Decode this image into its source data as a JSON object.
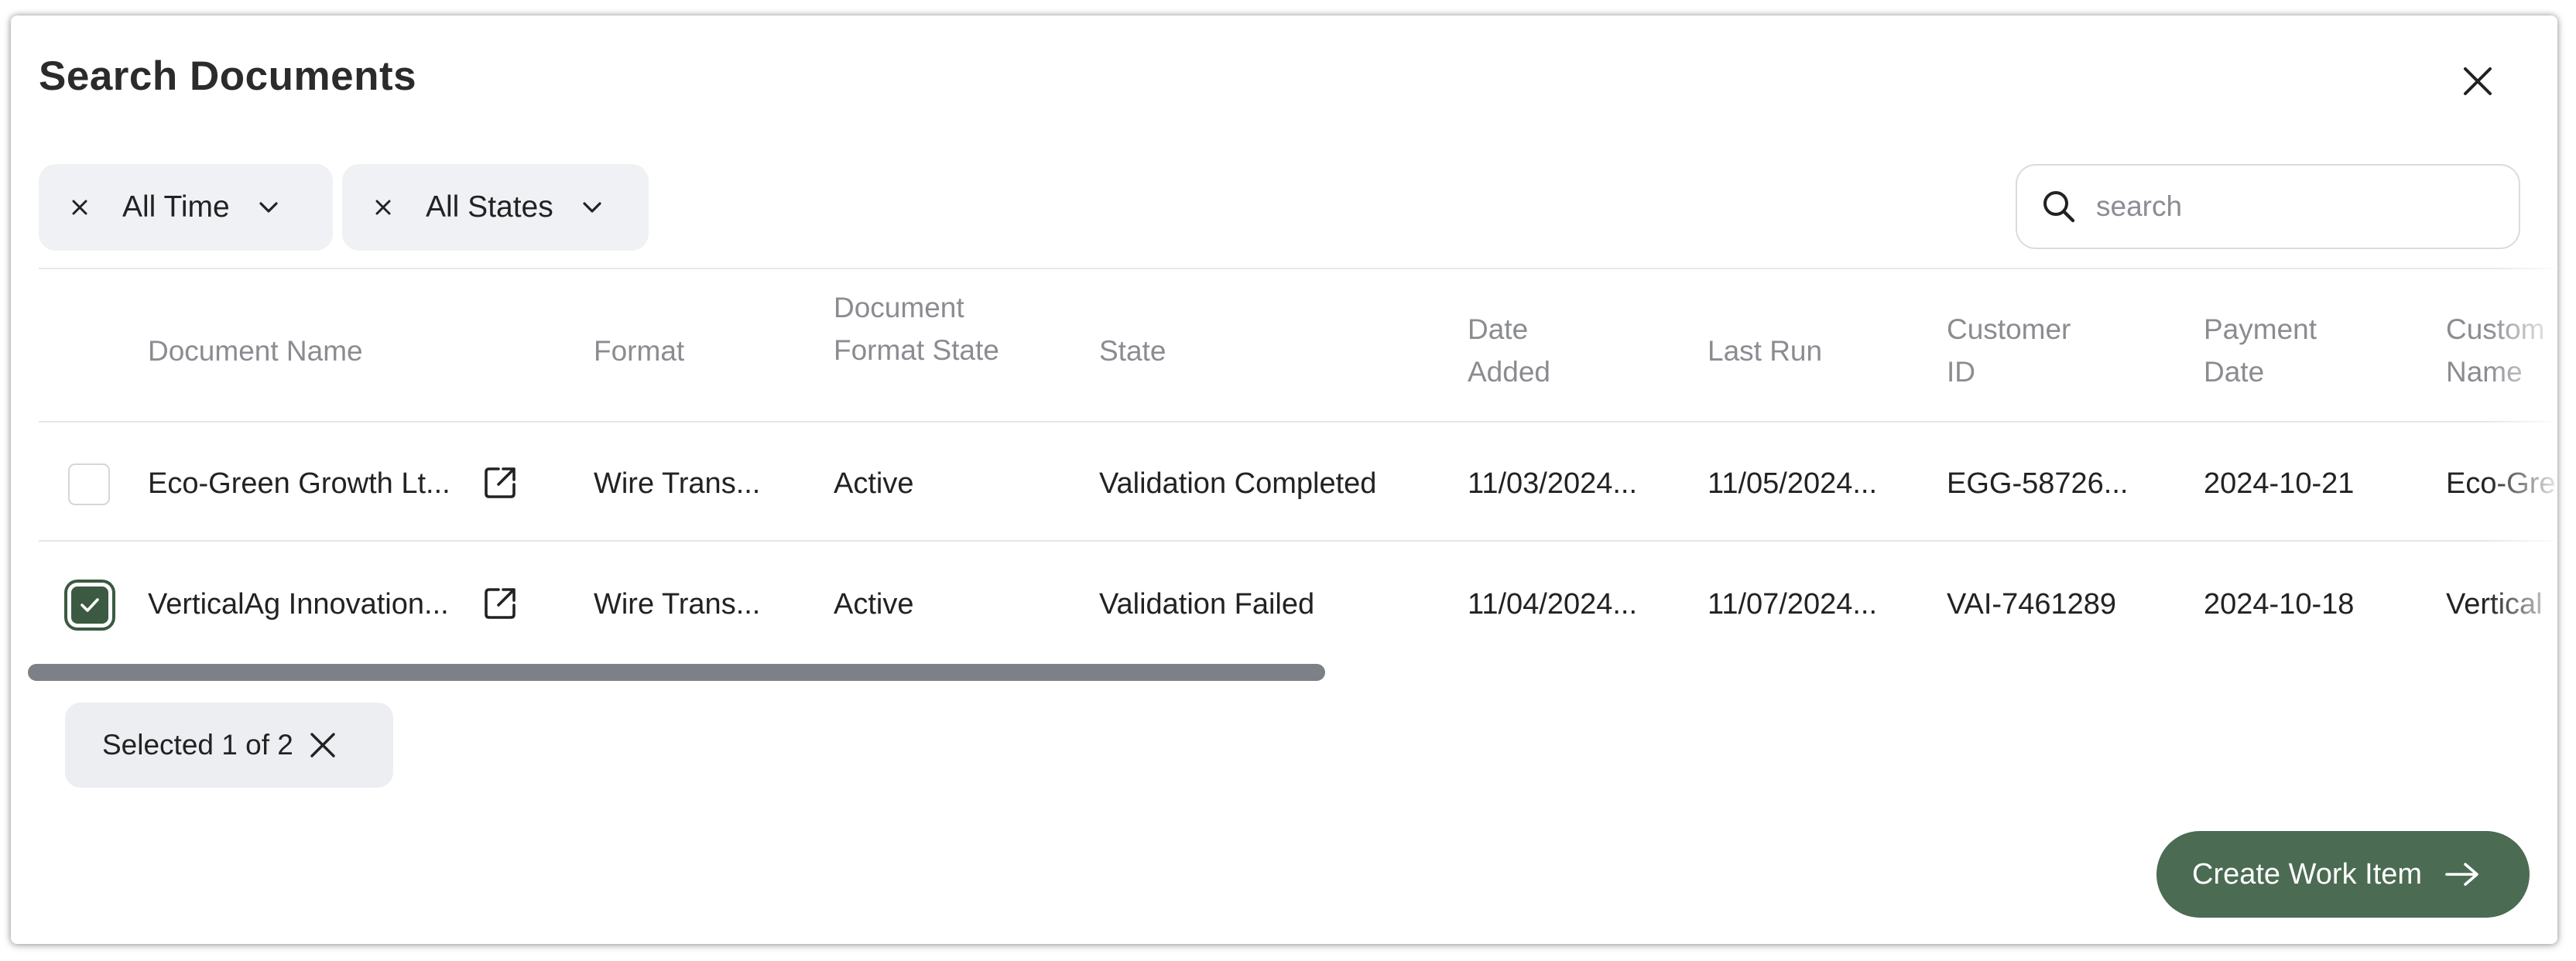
{
  "dialog": {
    "title": "Search Documents"
  },
  "filters": [
    {
      "label": "All Time"
    },
    {
      "label": "All States"
    }
  ],
  "search": {
    "placeholder": "search",
    "value": ""
  },
  "table": {
    "columns": [
      "Document Name",
      "Format",
      "Document Format State",
      "State",
      "Date Added",
      "Last Run",
      "Customer ID",
      "Payment Date",
      "Custom Name"
    ],
    "rows": [
      {
        "selected": false,
        "document_name": "Eco-Green Growth Lt...",
        "format": "Wire Trans...",
        "document_format_state": "Active",
        "state": "Validation Completed",
        "date_added": "11/03/2024...",
        "last_run": "11/05/2024...",
        "customer_id": "EGG-58726...",
        "payment_date": "2024-10-21",
        "customer_name": "Eco-Gre"
      },
      {
        "selected": true,
        "document_name": "VerticalAg Innovation...",
        "format": "Wire Trans...",
        "document_format_state": "Active",
        "state": "Validation Failed",
        "date_added": "11/04/2024...",
        "last_run": "11/07/2024...",
        "customer_id": "VAI-7461289",
        "payment_date": "2024-10-18",
        "customer_name": "Vertical"
      }
    ]
  },
  "selection": {
    "label": "Selected 1 of 2"
  },
  "actions": {
    "create_label": "Create Work Item"
  },
  "colors": {
    "accent": "#4b6b53",
    "checkbox_checked": "#3b5a41",
    "chip_bg": "#f0f1f5",
    "scrollbar": "#7d8087"
  }
}
